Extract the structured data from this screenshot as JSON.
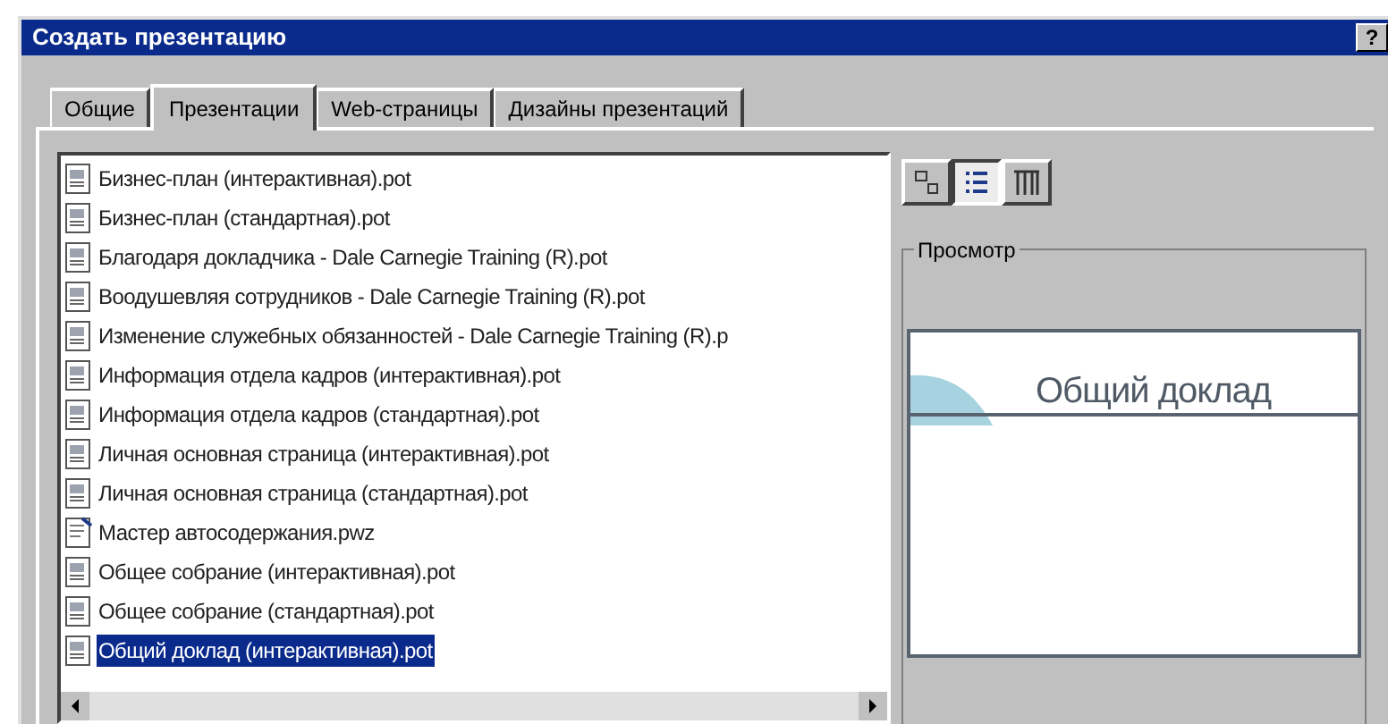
{
  "window": {
    "title": "Создать презентацию",
    "help_button": "?"
  },
  "tabs": [
    {
      "label": "Общие",
      "selected": false
    },
    {
      "label": "Презентации",
      "selected": true
    },
    {
      "label": "Web-страницы",
      "selected": false
    },
    {
      "label": "Дизайны презентаций",
      "selected": false
    }
  ],
  "files": [
    {
      "name": "Бизнес-план (интерактивная).pot",
      "kind": "template",
      "selected": false
    },
    {
      "name": "Бизнес-план (стандартная).pot",
      "kind": "template",
      "selected": false
    },
    {
      "name": "Благодаря докладчика - Dale Carnegie Training (R).pot",
      "kind": "template",
      "selected": false
    },
    {
      "name": "Воодушевляя сотрудников - Dale Carnegie Training (R).pot",
      "kind": "template",
      "selected": false
    },
    {
      "name": "Изменение служебных обязанностей - Dale Carnegie Training (R).p",
      "kind": "template",
      "selected": false
    },
    {
      "name": "Информация отдела кадров (интерактивная).pot",
      "kind": "template",
      "selected": false
    },
    {
      "name": "Информация отдела кадров (стандартная).pot",
      "kind": "template",
      "selected": false
    },
    {
      "name": "Личная основная страница (интерактивная).pot",
      "kind": "template",
      "selected": false
    },
    {
      "name": "Личная основная страница (стандартная).pot",
      "kind": "template",
      "selected": false
    },
    {
      "name": "Мастер автосодержания.pwz",
      "kind": "wizard",
      "selected": false
    },
    {
      "name": "Общее собрание (интерактивная).pot",
      "kind": "template",
      "selected": false
    },
    {
      "name": "Общее собрание (стандартная).pot",
      "kind": "template",
      "selected": false
    },
    {
      "name": "Общий доклад (интерактивная).pot",
      "kind": "template",
      "selected": true
    }
  ],
  "view_buttons": [
    {
      "kind": "large",
      "selected": false
    },
    {
      "kind": "list",
      "selected": true
    },
    {
      "kind": "details",
      "selected": false
    }
  ],
  "preview": {
    "label": "Просмотр",
    "slide_title": "Общий доклад"
  }
}
